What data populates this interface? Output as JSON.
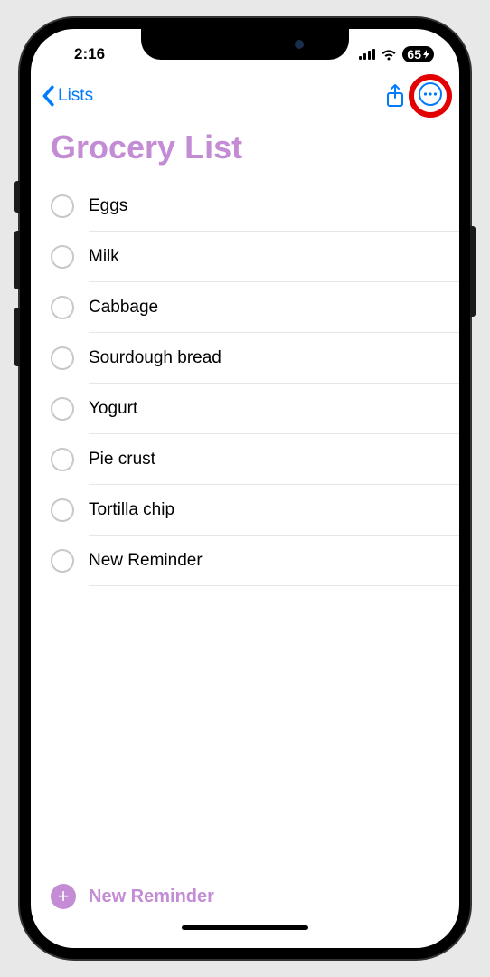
{
  "status": {
    "time": "2:16",
    "battery": "65"
  },
  "nav": {
    "back_label": "Lists"
  },
  "list": {
    "title": "Grocery List",
    "items": [
      {
        "text": "Eggs"
      },
      {
        "text": "Milk"
      },
      {
        "text": "Cabbage"
      },
      {
        "text": "Sourdough bread"
      },
      {
        "text": "Yogurt"
      },
      {
        "text": "Pie crust"
      },
      {
        "text": "Tortilla chip"
      },
      {
        "text": "New Reminder"
      }
    ]
  },
  "footer": {
    "new_reminder_label": "New Reminder"
  }
}
